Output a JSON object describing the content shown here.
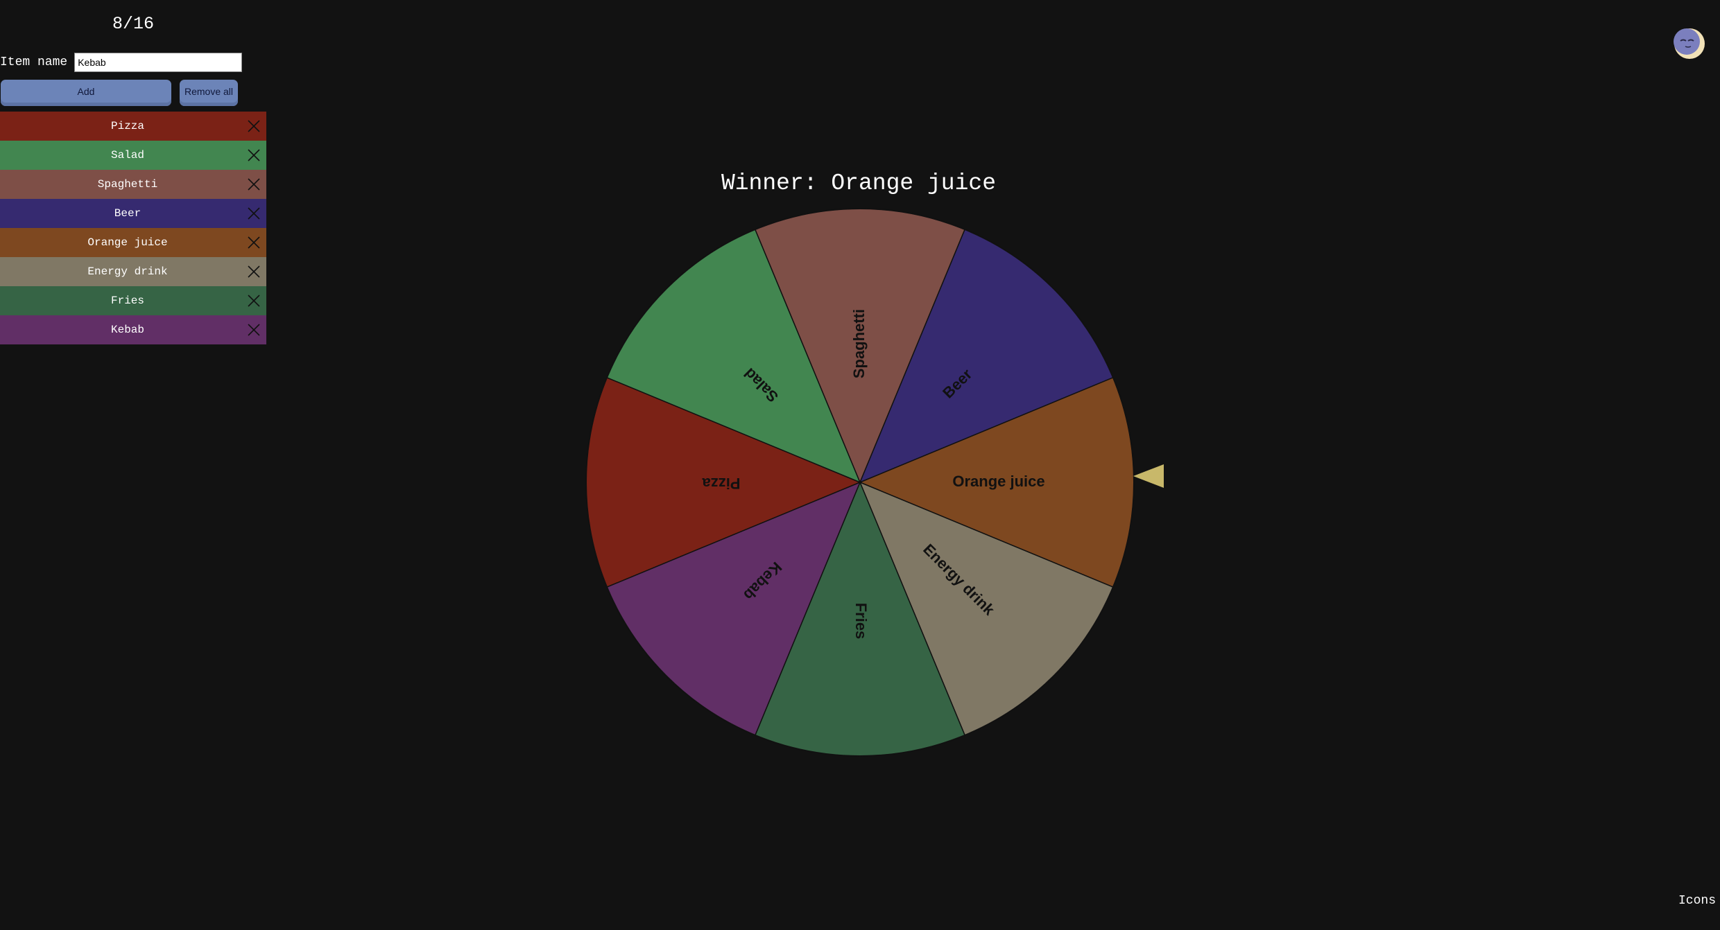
{
  "counter": "8/16",
  "form": {
    "label": "Item name",
    "value": "Kebab",
    "add_label": "Add",
    "remove_all_label": "Remove all"
  },
  "items": [
    {
      "label": "Pizza",
      "color": "#7b2216"
    },
    {
      "label": "Salad",
      "color": "#428650"
    },
    {
      "label": "Spaghetti",
      "color": "#7e4f47"
    },
    {
      "label": "Beer",
      "color": "#362a70"
    },
    {
      "label": "Orange juice",
      "color": "#7e4820"
    },
    {
      "label": "Energy drink",
      "color": "#807865"
    },
    {
      "label": "Fries",
      "color": "#366445"
    },
    {
      "label": "Kebab",
      "color": "#612f66"
    }
  ],
  "winner": "Winner: Orange juice",
  "icons_label": "Icons",
  "colors": {
    "background": "#121212",
    "button": "#6c84b8",
    "pointer": "#c8b86a"
  },
  "icons": {
    "remove": "close-icon",
    "theme": "moon-icon"
  }
}
